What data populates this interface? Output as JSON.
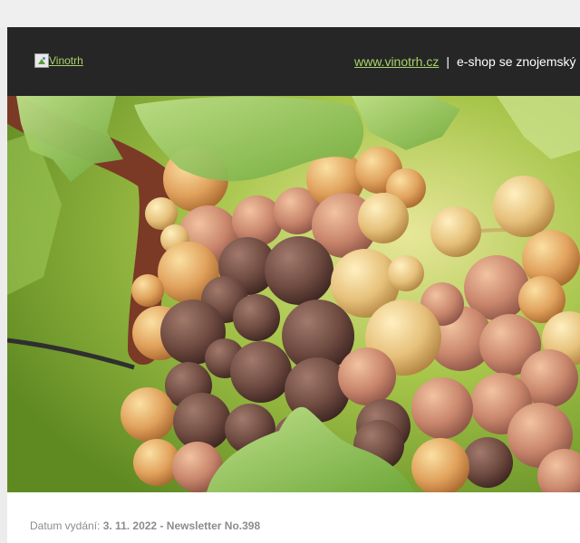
{
  "header": {
    "logo_alt": "Vinotrh",
    "site_link": "www.vinotrh.cz",
    "separator": "|",
    "tagline": "e-shop se znojemský"
  },
  "hero": {
    "image_icon": "grape-cluster-photo"
  },
  "issue": {
    "date_label": "Datum vydání:",
    "date_value": "3. 11. 2022 - Newsletter No.398"
  },
  "colors": {
    "header_bg": "#262626",
    "link": "#a9d26a",
    "muted_text": "#8c8c8c"
  }
}
